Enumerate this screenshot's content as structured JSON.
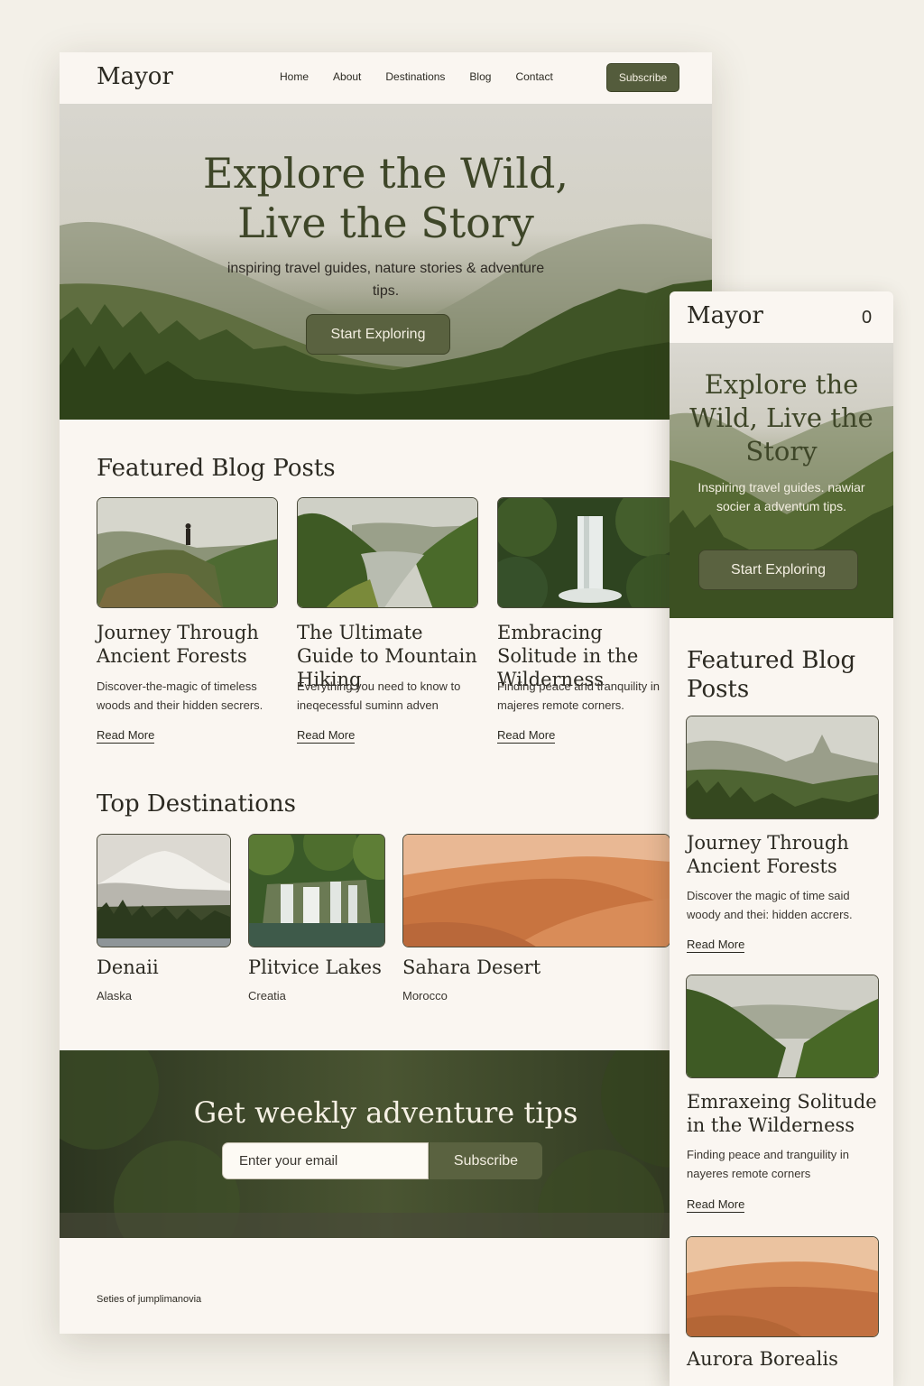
{
  "brand": "Mayor",
  "nav": {
    "links": [
      "Home",
      "About",
      "Destinations",
      "Blog",
      "Contact"
    ],
    "subscribe_label": "Subscribe"
  },
  "hero": {
    "title_line1": "Explore the Wild,",
    "title_line2": "Live the Story",
    "subtitle": "inspiring travel guides, nature stories & adventure tips.",
    "cta_label": "Start Exploring"
  },
  "featured": {
    "title": "Featured Blog Posts",
    "posts": [
      {
        "title": "Journey Through Ancient Forests",
        "desc": "Discover-the-magic of timeless woods and their hidden secrers.",
        "read_more": "Read More"
      },
      {
        "title": "The Ultimate Guide to Mountain Hiking",
        "desc": "Everything you need to know to ineqecessful suminn adven",
        "read_more": "Read More"
      },
      {
        "title": "Embracing Solitude in the Wilderness",
        "desc": "Finding peace and tranquility in majeres remote corners.",
        "read_more": "Read More"
      }
    ]
  },
  "destinations": {
    "title": "Top Destinations",
    "items": [
      {
        "name": "Denaii",
        "location": "Alaska"
      },
      {
        "name": "Plitvice Lakes",
        "location": "Creatia"
      },
      {
        "name": "Sahara Desert",
        "location": "Morocco"
      }
    ]
  },
  "newsletter": {
    "title": "Get weekly adventure tips",
    "email_placeholder": "Enter your email",
    "button_label": "Subscribe"
  },
  "footer": {
    "text": "Seties of jumplimanovia"
  },
  "mobile": {
    "brand": "Mayor",
    "menu_icon_glyph": "0",
    "hero_title": "Explore the Wild, Live the Story",
    "hero_subtitle": "Inspiring travel guides. nawiar socier a adventum tips.",
    "cta_label": "Start Exploring",
    "featured_title": "Featured Blog Posts",
    "posts": [
      {
        "title": "Journey Through Ancient Forests",
        "desc": "Discover the magic of time said woody and thei: hidden accrers.",
        "read_more": "Read More"
      },
      {
        "title": "Emraxeing Solitude in the Wilderness",
        "desc": "Finding peace and tranguility in nayeres remote corners",
        "read_more": "Read More"
      }
    ],
    "next_title": "Aurora Borealis"
  },
  "colors": {
    "accent": "#5a6240",
    "background": "#faf6f1",
    "page_bg": "#f3f0e8",
    "heading_green": "#3e4628"
  }
}
